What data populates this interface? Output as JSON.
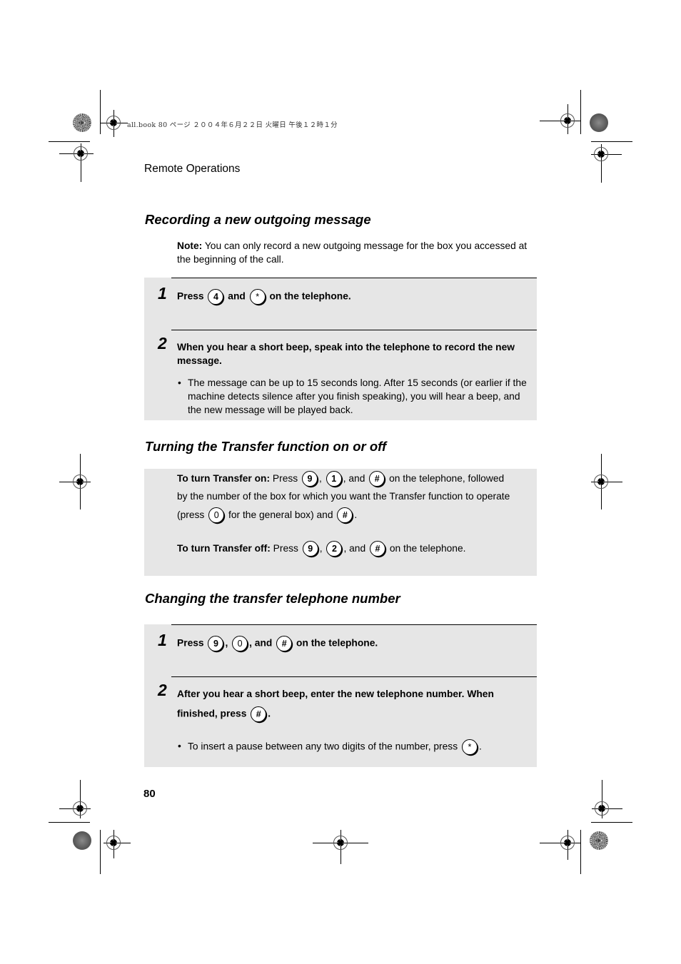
{
  "slug": "all.book  80 ページ  ２００４年６月２２日  火曜日  午後１２時１分",
  "running_head": "Remote Operations",
  "page_number": "80",
  "section1": {
    "title": "Recording a new outgoing message",
    "note_label": "Note:",
    "note_text": " You can only record a new outgoing message for the box you accessed at the beginning of the call.",
    "steps": [
      {
        "number": "1",
        "parts": {
          "press": "Press",
          "key1": "4",
          "and": "and",
          "key2": "*",
          "tail": "on the telephone."
        }
      },
      {
        "number": "2",
        "text": "When you hear a short beep, speak into the telephone to record the new message.",
        "bullet": "The message can be up to 15 seconds long. After 15 seconds (or earlier if the machine detects silence after you finish speaking), you will hear a beep, and the new message will be played back."
      }
    ]
  },
  "section2": {
    "title": "Turning the Transfer function on or off",
    "on": {
      "label": "To turn Transfer on:",
      "press": "Press",
      "key1": "9",
      "comma1": ",",
      "key2": "1",
      "and": ", and",
      "key3": "#",
      "tail1": "on the telephone, followed",
      "line2": "by the number of the box for which you want the Transfer function to operate",
      "line3_pre": "(press",
      "key4": "0",
      "line3_mid": "for the general box) and",
      "key5": "#",
      "line3_end": "."
    },
    "off": {
      "label": "To turn Transfer off:",
      "press": "Press",
      "key1": "9",
      "comma1": ",",
      "key2": "2",
      "and": ", and",
      "key3": "#",
      "tail": "on the telephone."
    }
  },
  "section3": {
    "title": "Changing the transfer telephone number",
    "steps": [
      {
        "number": "1",
        "parts": {
          "press": "Press",
          "key1": "9",
          "comma": ",",
          "key2": "0",
          "and": ", and",
          "key3": "#",
          "tail": "on the telephone."
        }
      },
      {
        "number": "2",
        "line1": "After you hear a short beep, enter the new telephone number. When",
        "line2": "finished, press",
        "key": "#",
        "end": ".",
        "bullet_text": "To insert a pause between any two digits of the number, press",
        "bullet_key": "*",
        "bullet_end": "."
      }
    ]
  },
  "bullet_glyph": "•"
}
